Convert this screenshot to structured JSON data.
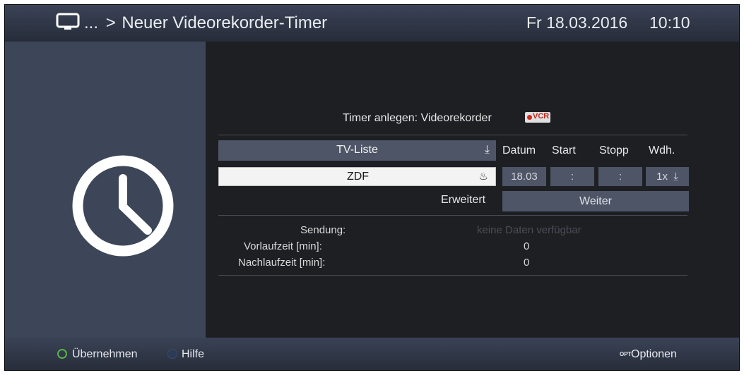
{
  "header": {
    "breadcrumb_prefix": "...",
    "separator": ">",
    "title": "Neuer Videorekorder-Timer",
    "date": "Fr 18.03.2016",
    "time": "10:10",
    "icon": "tv-icon"
  },
  "left_panel": {
    "icon": "clock-icon"
  },
  "main": {
    "heading": "Timer anlegen: Videorekorder",
    "badge": "VCR",
    "list_select": {
      "label": "TV-Liste",
      "icon": "download-arrow-icon"
    },
    "channel_select": {
      "label": "ZDF",
      "icon": "record-icon"
    },
    "columns": {
      "datum": "Datum",
      "start": "Start",
      "stopp": "Stopp",
      "wdh": "Wdh."
    },
    "values": {
      "datum": "18.03",
      "start": ":",
      "stopp": ":",
      "wdh": "1x"
    },
    "erweitert_label": "Erweitert",
    "weiter_button": "Weiter",
    "info": {
      "sendung_label": "Sendung:",
      "sendung_value": "keine Daten verfügbar",
      "vorlauf_label": "Vorlaufzeit [min]:",
      "vorlauf_value": "0",
      "nachlauf_label": "Nachlaufzeit [min]:",
      "nachlauf_value": "0"
    }
  },
  "footer": {
    "green_label": "Übernehmen",
    "blue_label": "Hilfe",
    "opt_badge": "OPT",
    "options_label": "Optionen"
  },
  "colors": {
    "header_bg": "#2e3543",
    "panel_bg": "#3d4658",
    "main_bg": "#1e1f23",
    "field_bg": "#4e5566",
    "selected_field": "#f3f3f3",
    "green": "#59b04a",
    "vcr_red": "#c0281e"
  }
}
